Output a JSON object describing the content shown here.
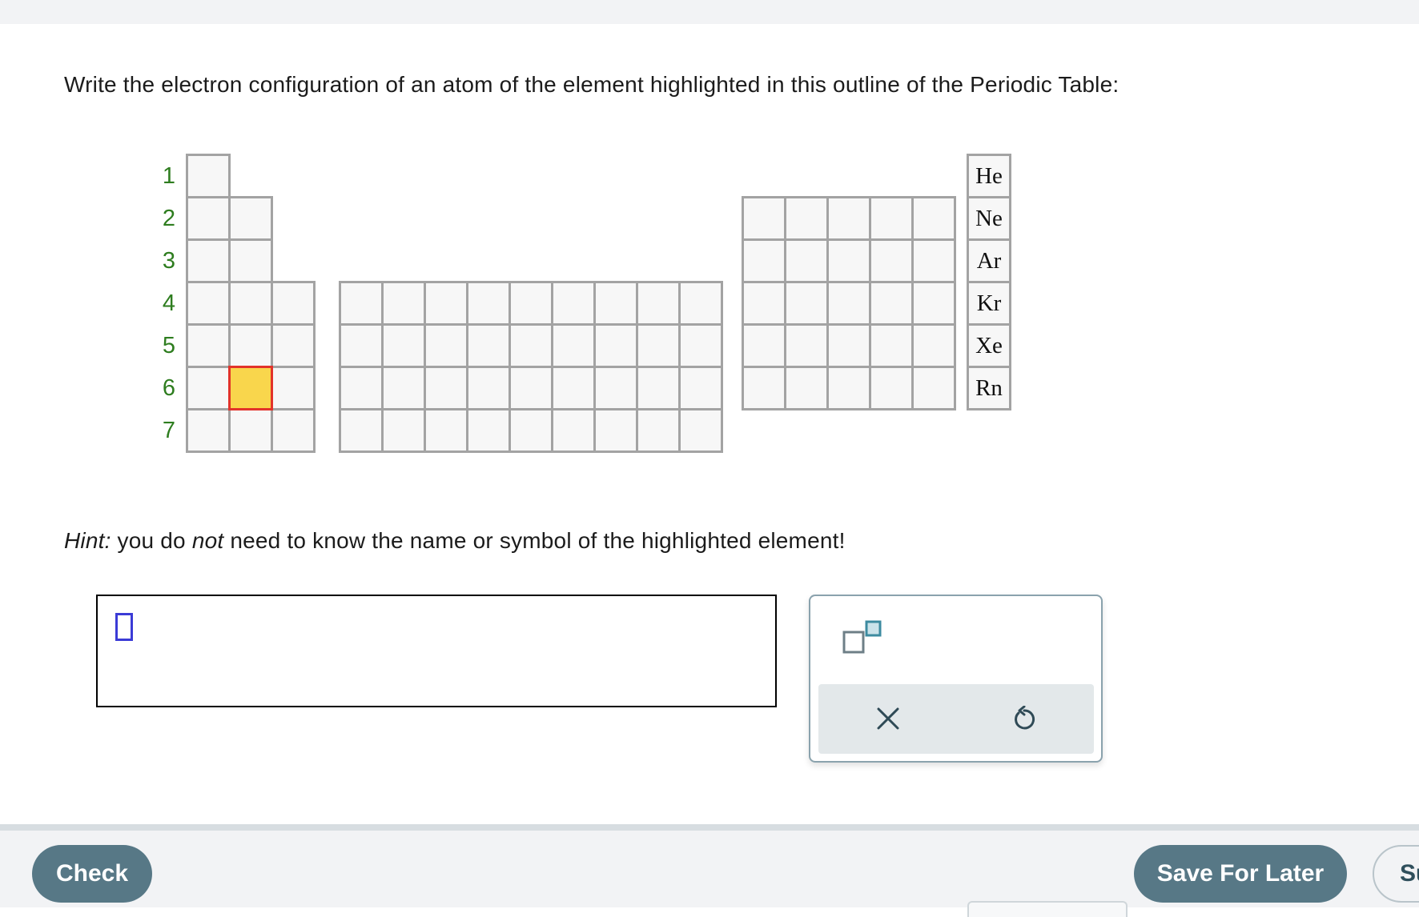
{
  "question": {
    "text": "Write the electron configuration of an atom of the element highlighted in this outline of the Periodic Table:"
  },
  "periodic_table": {
    "period_labels": [
      "1",
      "2",
      "3",
      "4",
      "5",
      "6",
      "7"
    ],
    "noble_gases": [
      "He",
      "Ne",
      "Ar",
      "Kr",
      "Xe",
      "Rn"
    ],
    "highlighted": {
      "period": 6,
      "group": 2
    },
    "colors": {
      "highlight_fill": "#f9d64c",
      "highlight_border": "#e2332a",
      "period_label": "#2e7d1f",
      "cell_border": "#a3a3a3"
    }
  },
  "hint": {
    "label": "Hint:",
    "part1": " you do ",
    "emph": "not",
    "part2": " need to know the name or symbol of the highlighted element!"
  },
  "answer": {
    "value": ""
  },
  "palette": {
    "tools": [
      {
        "name": "superscript-tool",
        "icon": "superscript-icon"
      },
      {
        "name": "clear-tool",
        "icon": "x-icon"
      },
      {
        "name": "undo-tool",
        "icon": "undo-icon"
      }
    ]
  },
  "footer": {
    "check_label": "Check",
    "save_label": "Save For Later",
    "submit_label": "Submit Assignment",
    "accent": "#577886"
  }
}
